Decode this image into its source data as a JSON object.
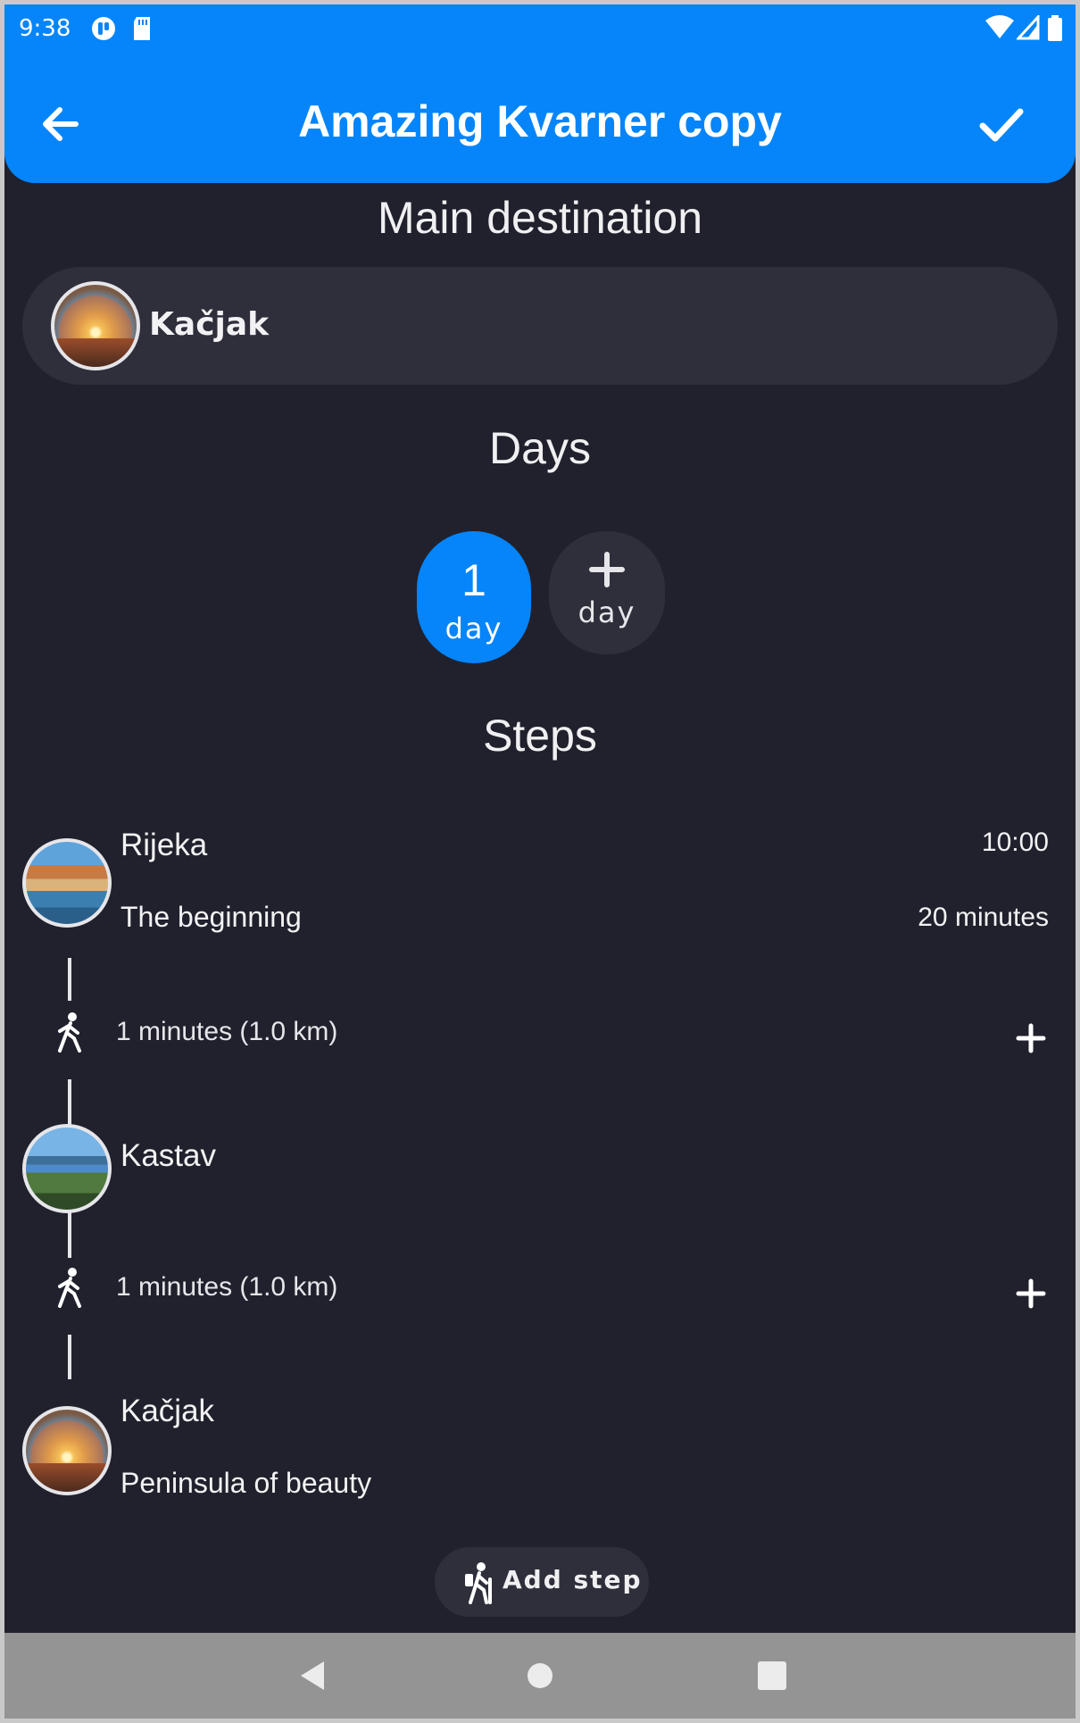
{
  "status_bar": {
    "time": "9:38",
    "icons": [
      "cast-icon",
      "sd-card-icon",
      "wifi-icon",
      "signal-icon",
      "battery-icon"
    ]
  },
  "app_bar": {
    "title": "Amazing Kvarner copy",
    "back_icon": "arrow-left-icon",
    "confirm_icon": "check-icon",
    "color": "#0585f9"
  },
  "main_destination": {
    "heading": "Main destination",
    "name": "Kačjak",
    "image": "sunset-photo"
  },
  "days": {
    "heading": "Days",
    "items": [
      {
        "number": "1",
        "label": "day",
        "selected": true
      }
    ],
    "add": {
      "label": "day",
      "icon": "plus-icon"
    }
  },
  "steps": {
    "heading": "Steps",
    "items": [
      {
        "name": "Rijeka",
        "subtitle": "The beginning",
        "time": "10:00",
        "duration": "20 minutes",
        "image": "rijeka-photo"
      },
      {
        "name": "Kastav",
        "subtitle": "",
        "time": "",
        "duration": "",
        "image": "kastav-photo"
      },
      {
        "name": "Kačjak",
        "subtitle": "Peninsula of beauty",
        "time": "",
        "duration": "",
        "image": "sunset-photo"
      }
    ],
    "travel": [
      {
        "mode_icon": "walk-icon",
        "text": "1 minutes (1.0 km)"
      },
      {
        "mode_icon": "walk-icon",
        "text": "1 minutes (1.0 km)"
      }
    ],
    "add_step_label": "Add step"
  },
  "nav_bar": {
    "buttons": [
      "back-triangle-icon",
      "home-circle-icon",
      "recents-square-icon"
    ]
  }
}
